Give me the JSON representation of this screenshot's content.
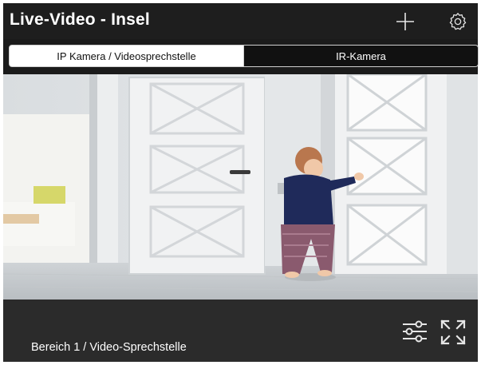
{
  "header": {
    "title": "Live-Video - Insel",
    "add_icon": "plus-icon",
    "settings_icon": "gear-icon"
  },
  "tabs": [
    {
      "label": "IP Kamera / Videosprechstelle",
      "active": true
    },
    {
      "label": "IR-Kamera",
      "active": false
    }
  ],
  "video": {
    "content": "camera-feed-image"
  },
  "footer": {
    "area_label": "Bereich 1 / Video-Sprechstelle",
    "filter_icon": "sliders-icon",
    "fullscreen_icon": "expand-icon"
  },
  "colors": {
    "header_bg": "#1e1e1e",
    "tabbar_bg": "#1b1b1b",
    "footer_bg": "#2b2b2b",
    "active_tab_bg": "#ffffff",
    "inactive_tab_bg": "#111111"
  }
}
